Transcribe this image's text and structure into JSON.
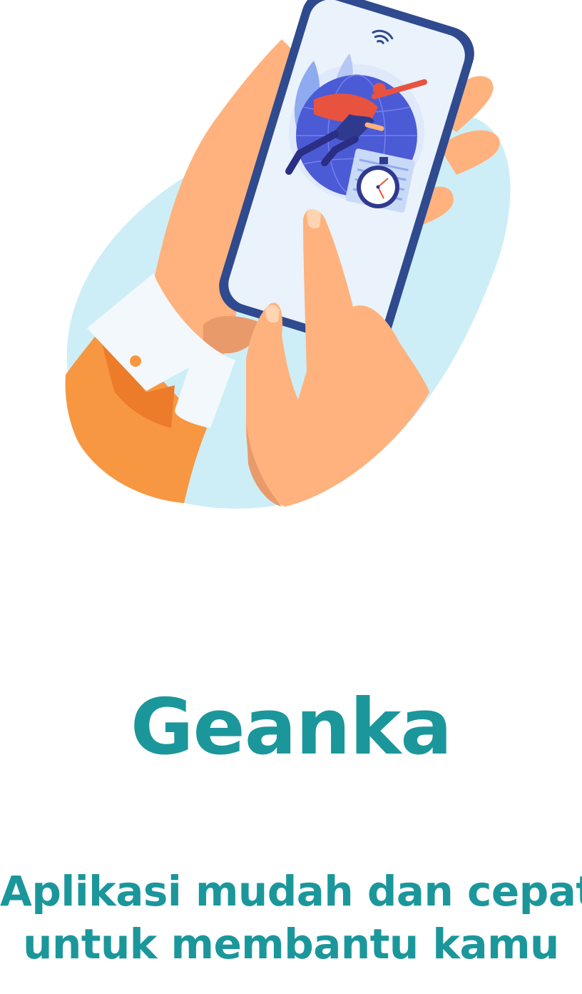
{
  "app": {
    "name": "Geanka",
    "tagline_line1": "Aplikasi mudah dan cepat",
    "tagline_line2": "untuk membantu kamu"
  },
  "colors": {
    "brand_teal": "#1b979b",
    "blob_light_blue": "#cdeef6",
    "skin": "#ffb27d",
    "skin_shadow": "#e99a6b",
    "sleeve_orange": "#f79741",
    "cuff_white": "#f2f8fc",
    "phone_frame": "#2f4a8e",
    "phone_screen": "#eaf2fb",
    "globe_blue": "#4b5bd6",
    "hero_red": "#e8533f"
  },
  "icons": {
    "wifi": "wifi-icon",
    "stopwatch": "stopwatch-icon",
    "globe": "globe-icon"
  }
}
